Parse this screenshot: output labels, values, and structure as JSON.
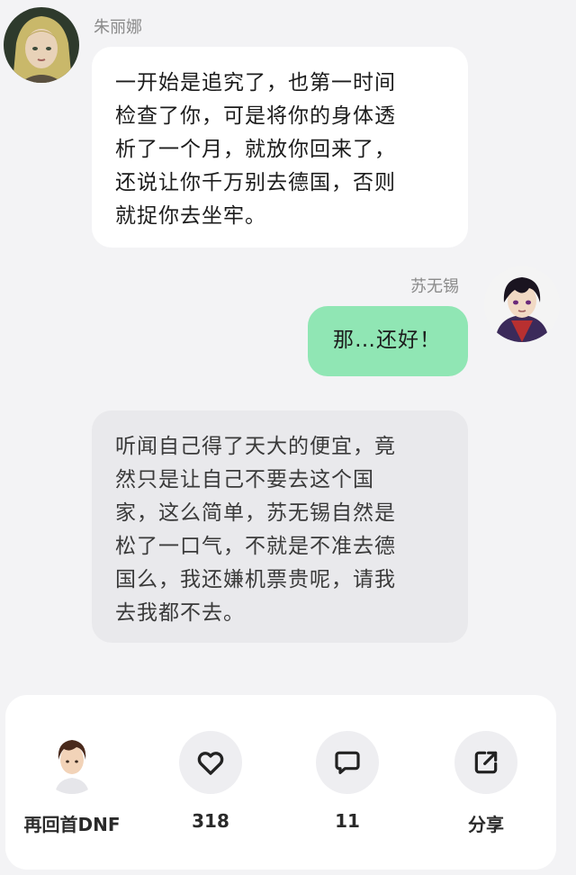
{
  "messages": [
    {
      "speaker": "朱丽娜",
      "lines": [
        "一开始是追究了，也第一时间",
        "检查了你，可是将你的身体透",
        "析了一个月，就放你回来了，",
        "还说让你千万别去德国，否则",
        "就捉你去坐牢。"
      ]
    },
    {
      "speaker": "苏无锡",
      "lines": [
        "那…还好！"
      ]
    },
    {
      "speaker": "",
      "lines": [
        "听闻自己得了天大的便宜，竟",
        "然只是让自己不要去这个国",
        "家，这么简单，苏无锡自然是",
        "松了一口气，不就是不准去德",
        "国么，我还嫌机票贵呢，请我",
        "去我都不去。"
      ]
    }
  ],
  "bottom_bar": {
    "author": "再回首DNF",
    "likes": "318",
    "comments": "11",
    "share": "分享"
  },
  "icons": {
    "like": "heart-icon",
    "comment": "comment-bubble-icon",
    "share": "share-icon"
  },
  "colors": {
    "background": "#f3f3f5",
    "my_bubble": "#90e6b4",
    "other_bubble": "#ffffff",
    "narration_bubble": "#e9e9ec"
  }
}
